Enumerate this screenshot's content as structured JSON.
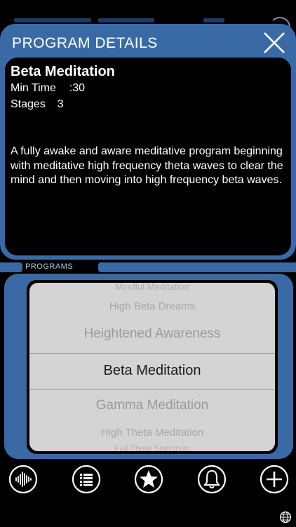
{
  "details": {
    "title": "PROGRAM DETAILS",
    "program_name": "Beta Meditation",
    "min_time_label": "Min Time",
    "min_time_value": ":30",
    "stages_label": "Stages",
    "stages_value": "3",
    "description": "A fully awake and aware meditative program beginning with meditative high frequency theta waves to clear the mind and then moving into high frequency beta waves."
  },
  "programs": {
    "label": "PROGRAMS",
    "items": [
      "Mindful Meditation",
      "High Beta Dreams",
      "Heightened Awareness",
      "Beta Meditation",
      "Gamma Meditation",
      "High Theta Meditation",
      "Full Theta Spectrum"
    ],
    "selected": "Beta Meditation"
  },
  "toolbar": {
    "icons": [
      "waveform-icon",
      "list-icon",
      "star-icon",
      "bell-icon",
      "plus-icon",
      "globe-icon"
    ]
  },
  "colors": {
    "panel_blue": "#3a6aa6",
    "background": "#000000",
    "picker_bg": "#d4d4d4"
  }
}
